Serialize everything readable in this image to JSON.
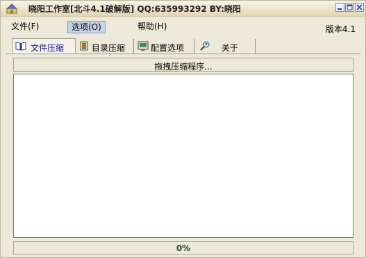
{
  "window": {
    "title": "晓阳工作室[北斗4.1破解版] QQ:635993292 BY:晓阳"
  },
  "menu": {
    "items": [
      {
        "label": "文件(F)"
      },
      {
        "label": "选项(O)"
      },
      {
        "label": "帮助(H)"
      }
    ],
    "version": "版本4.1"
  },
  "tabs": [
    {
      "label": "文件压缩",
      "icon": "book-icon"
    },
    {
      "label": "目录压缩",
      "icon": "folder-stack-icon"
    },
    {
      "label": "配置选项",
      "icon": "config-icon"
    },
    {
      "label": "关于",
      "icon": "search-person-icon"
    }
  ],
  "main": {
    "banner": "拖拽压缩程序...",
    "progress_text": "0%"
  },
  "colors": {
    "progress_text": "#1a4d1a",
    "menu_highlight": "#c6d3e8"
  }
}
